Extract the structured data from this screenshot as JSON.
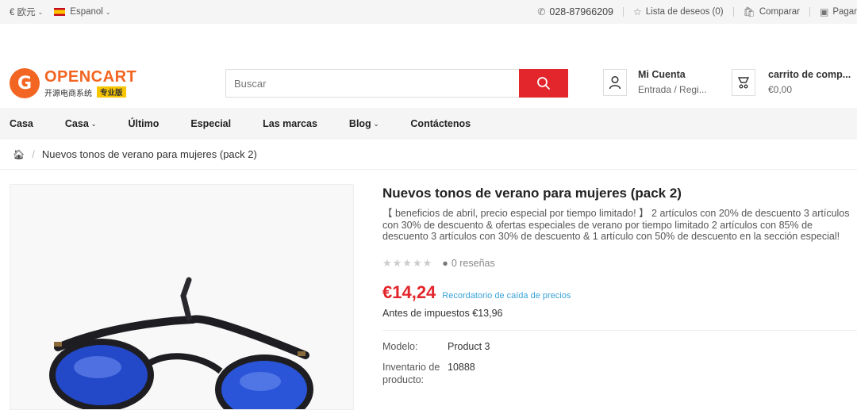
{
  "topbar": {
    "currency": "€ 欧元",
    "language": "Espanol",
    "phone": "028-87966209",
    "wishlist": "Lista de deseos (0)",
    "compare": "Comparar",
    "checkout": "Pagar"
  },
  "header": {
    "logo_name": "OPENCART",
    "logo_sub": "开源电商系统",
    "logo_badge": "专业版",
    "search_placeholder": "Buscar",
    "account_title": "Mi Cuenta",
    "account_sub": "Entrada / Regi...",
    "cart_title": "carrito de comp...",
    "cart_total": "€0,00"
  },
  "nav": {
    "items": [
      "Casa",
      "Casa",
      "Último",
      "Especial",
      "Las marcas",
      "Blog",
      "Contáctenos"
    ]
  },
  "breadcrumb": {
    "current": "Nuevos tonos de verano para mujeres (pack 2)"
  },
  "product": {
    "title": "Nuevos tonos de verano para mujeres (pack 2)",
    "description": "【 beneficios de abril, precio especial por tiempo limitado! 】 2 artículos con 20% de descuento 3 artículos con 30% de descuento & ofertas especiales de verano por tiempo limitado 2 artículos con 85% de descuento 3 artículos con 30% de descuento & 1 artículo con 50% de descuento en la sección especial!",
    "reviews": "0 reseñas",
    "rating_stars": 0,
    "price": "€14,24",
    "price_drop_link": "Recordatorio de caída de precios",
    "ex_tax": "Antes de impuestos €13,96",
    "specs": [
      {
        "label": "Modelo:",
        "value": "Product 3"
      },
      {
        "label": "Inventario de producto:",
        "value": "10888"
      }
    ],
    "colors": {
      "price": "#e2262b",
      "accent": "#f26522",
      "link": "#3aa3d9"
    }
  }
}
